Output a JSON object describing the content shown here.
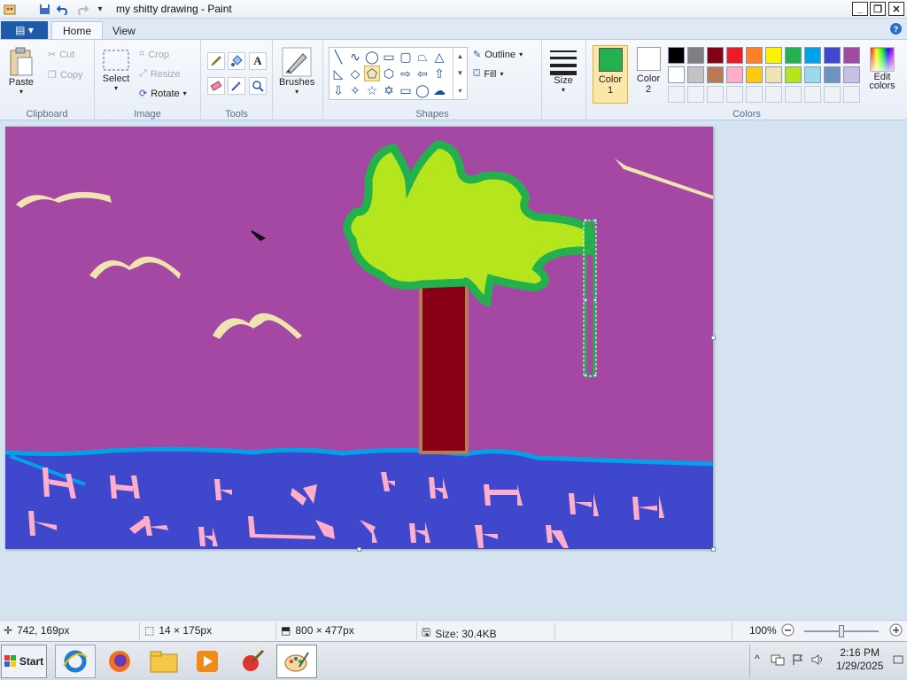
{
  "window": {
    "title": "my shitty drawing - Paint",
    "controls": [
      "_",
      "❐",
      "✕"
    ]
  },
  "tabs": {
    "file": "▤ ▾",
    "home": "Home",
    "view": "View"
  },
  "ribbon": {
    "clipboard": {
      "paste": "Paste",
      "cut": "Cut",
      "copy": "Copy",
      "label": "Clipboard"
    },
    "image": {
      "select": "Select",
      "crop": "Crop",
      "resize": "Resize",
      "rotate": "Rotate",
      "label": "Image"
    },
    "tools": {
      "label": "Tools"
    },
    "brushes": {
      "label": "Brushes"
    },
    "shapes": {
      "outline": "Outline",
      "fill": "Fill",
      "label": "Shapes"
    },
    "size": {
      "label": "Size"
    },
    "colors": {
      "color1": "Color",
      "color1_num": "1",
      "color2": "Color",
      "color2_num": "2",
      "edit": "Edit",
      "edit2": "colors",
      "label": "Colors",
      "color1_value": "#22b14c",
      "color2_value": "#ffffff",
      "palette_row1": [
        "#000000",
        "#7f7f7f",
        "#880015",
        "#ed1c24",
        "#ff7f27",
        "#fff200",
        "#22b14c",
        "#00a2e8",
        "#3f48cc",
        "#a349a4"
      ],
      "palette_row2": [
        "#ffffff",
        "#c3c3c3",
        "#b97a57",
        "#ffaec9",
        "#ffc90e",
        "#efe4b0",
        "#b5e61d",
        "#99d9ea",
        "#7092be",
        "#c8bfe7"
      ]
    }
  },
  "canvas": {
    "background": "#a548a4",
    "water": "#3f48cc",
    "foliage": "#b5e61d",
    "trunk": "#880015"
  },
  "status": {
    "cursor_pos": "742, 169px",
    "selection_size": "14 × 175px",
    "canvas_size": "800 × 477px",
    "file_size": "Size: 30.4KB",
    "zoom": "100%"
  },
  "taskbar": {
    "start": "Start",
    "time": "2:16 PM",
    "date": "1/29/2025"
  }
}
